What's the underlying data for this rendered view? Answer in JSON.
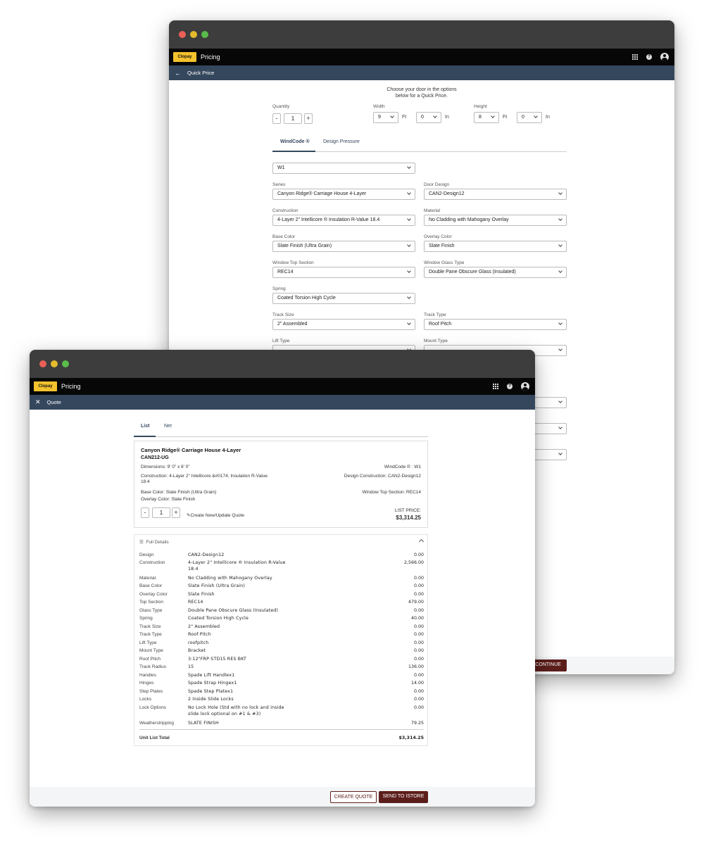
{
  "app": {
    "brand": "Clopay",
    "title": "Pricing"
  },
  "back": {
    "nav_title": "Quick Price",
    "intro_line1": "Choose your door in the options",
    "intro_line2": "below for a Quick Price.",
    "quantity_label": "Quantity",
    "quantity_value": "1",
    "minus": "-",
    "plus": "+",
    "width_label": "Width",
    "width_ft": "9",
    "width_in": "0",
    "height_label": "Height",
    "height_ft": "8",
    "height_in": "0",
    "ft_unit": "Ft",
    "in_unit": "In",
    "tabs": [
      "WindCode ®",
      "Design Pressure"
    ],
    "windcode_value": "W1",
    "fields": {
      "series": {
        "label": "Series",
        "value": "Canyon Ridge® Carriage House 4-Layer"
      },
      "door_design": {
        "label": "Door Design",
        "value": "CAN2-Design12"
      },
      "construction": {
        "label": "Construction",
        "value": "4-Layer 2\" Intellicore ® Insulation R-Value 18.4"
      },
      "material": {
        "label": "Material",
        "value": "No Cladding with Mahogany Overlay"
      },
      "base_color": {
        "label": "Base Color",
        "value": "Slate Finish (Ultra Grain)"
      },
      "overlay_color": {
        "label": "Overlay Color",
        "value": "Slate Finish"
      },
      "window_top": {
        "label": "Window Top Section",
        "value": "REC14"
      },
      "window_glass": {
        "label": "Window Glass Type",
        "value": "Double Pane Obscure Glass (Insulated)"
      },
      "spring": {
        "label": "Spring",
        "value": "Coated Torsion High Cycle"
      },
      "track_size": {
        "label": "Track Size",
        "value": "2\" Assembled"
      },
      "track_type": {
        "label": "Track Type",
        "value": "Roof Pitch"
      },
      "lift_type": {
        "label": "Lift Type",
        "value": ""
      },
      "mount_type": {
        "label": "Mount Type",
        "value": ""
      }
    },
    "continue_label": "CONTINUE"
  },
  "front": {
    "nav_title": "Quote",
    "tabs": [
      "List",
      "Net"
    ],
    "product_name": "Canyon Ridge® Carriage House 4-Layer",
    "product_code": "CAN212-UG",
    "dimensions": "Dimensions: 9' 0\" x 8' 0\"",
    "windcode": "WindCode ® : W1",
    "construction_line1": "Construction: 4-Layer 2\" Intellicore &#0174; Insulation R-Value",
    "construction_line2": "18.4",
    "design_construction": "Design Construction: CAN2-Design12",
    "base_color": "Base Color: Slate Finish (Ultra Grain)",
    "overlay_color": "Overlay Color: Slate Finish",
    "window_top": "Window Top Section: REC14",
    "quantity": "1",
    "minus": "-",
    "plus": "+",
    "create_update": "Create New/Update Quote",
    "list_price_label": "LIST PRICE:",
    "list_price": "$3,314.25",
    "full_details": "Full Details",
    "details": [
      {
        "label": "Design",
        "value": "CAN2-Design12",
        "price": "0.00"
      },
      {
        "label": "Construction",
        "value": "4-Layer 2\" Intellicore ® Insulation R-Value",
        "value2": "18.4",
        "price": "2,566.00"
      },
      {
        "label": "Material",
        "value": "No Cladding with Mahogany Overlay",
        "price": "0.00"
      },
      {
        "label": "Base Color",
        "value": "Slate Finish (Ultra Grain)",
        "price": "0.00"
      },
      {
        "label": "Overlay Color",
        "value": "Slate Finish",
        "price": "0.00"
      },
      {
        "label": "Top Section",
        "value": "REC14",
        "price": "479.00"
      },
      {
        "label": "Glass Type",
        "value": "Double Pane Obscure Glass (Insulated)",
        "price": "0.00"
      },
      {
        "label": "Spring",
        "value": "Coated Torsion High Cycle",
        "price": "40.00"
      },
      {
        "label": "Track Size",
        "value": "2\" Assembled",
        "price": "0.00"
      },
      {
        "label": "Track Type",
        "value": "Roof Pitch",
        "price": "0.00"
      },
      {
        "label": "Lift Type",
        "value": "roofpitch",
        "price": "0.00"
      },
      {
        "label": "Mount Type",
        "value": "Bracket",
        "price": "0.00"
      },
      {
        "label": "Roof Pitch",
        "value": "3:12\"FRP STD15 RES BKT",
        "price": "0.00"
      },
      {
        "label": "Track Radius",
        "value": "15",
        "price": "136.00"
      },
      {
        "label": "Handles",
        "value": "Spade Lift Handlex1",
        "price": "0.00"
      },
      {
        "label": "Hinges",
        "value": "Spade Strap Hingex1",
        "price": "14.00"
      },
      {
        "label": "Step Plates",
        "value": "Spade Step Platex1",
        "price": "0.00"
      },
      {
        "label": "Locks",
        "value": "2 Inside Slide Locks",
        "price": "0.00"
      },
      {
        "label": "Lock Options",
        "value": "No Lock Hole (Std with no lock and inside",
        "value2": "slide lock optional on #1 & #3)",
        "price": "0.00"
      },
      {
        "label": "Weatherstripping",
        "value": "SLATE FINISH",
        "price": "79.25"
      }
    ],
    "unit_total_label": "Unit List Total",
    "unit_total": "$3,314.25",
    "create_quote": "CREATE QUOTE",
    "send_to_istore": "SEND TO ISTORE"
  },
  "colors": {
    "nav": "#35475d",
    "accent": "#5c1e1b",
    "brand": "#f4c22d"
  }
}
